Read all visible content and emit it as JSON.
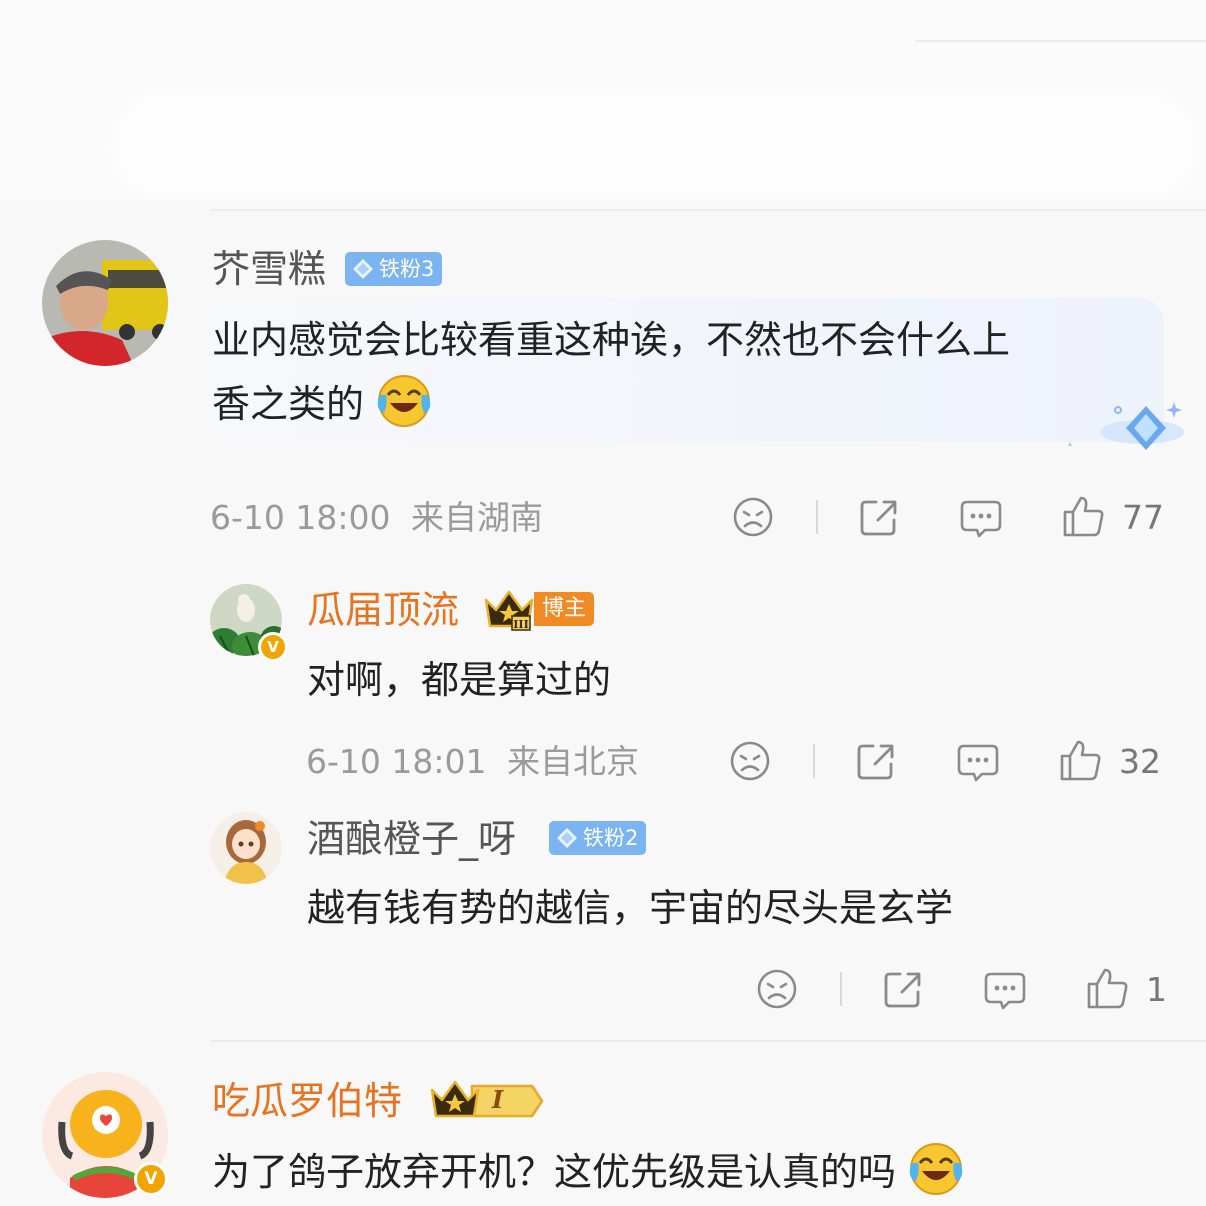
{
  "comments": [
    {
      "user": "芥雪糕",
      "badge": "铁粉3",
      "text_line1": "业内感觉会比较看重这种诶，不然也不会什么上",
      "text_line2": "香之类的",
      "time": "6-10 18:00",
      "location": "来自湖南",
      "likes": "77"
    },
    {
      "user": "瓜届顶流",
      "badge": "博主",
      "text": "对啊，都是算过的",
      "time": "6-10 18:01",
      "location": "来自北京",
      "likes": "32"
    },
    {
      "user": "酒酿橙子_呀",
      "badge": "铁粉2",
      "text": "越有钱有势的越信，宇宙的尽头是玄学",
      "likes": "1"
    },
    {
      "user": "吃瓜罗伯特",
      "badge": "I",
      "text": "为了鸽子放弃开机？这优先级是认真的吗"
    }
  ],
  "colors": {
    "accent_orange": "#e8731f",
    "badge_blue": "#7bb4f0",
    "meta_gray": "#9a9a9a"
  },
  "icons": [
    "dislike-icon",
    "share-icon",
    "reply-icon",
    "like-icon",
    "laugh-cry-emoji",
    "crown-icon",
    "diamond-icon",
    "verified-icon"
  ]
}
